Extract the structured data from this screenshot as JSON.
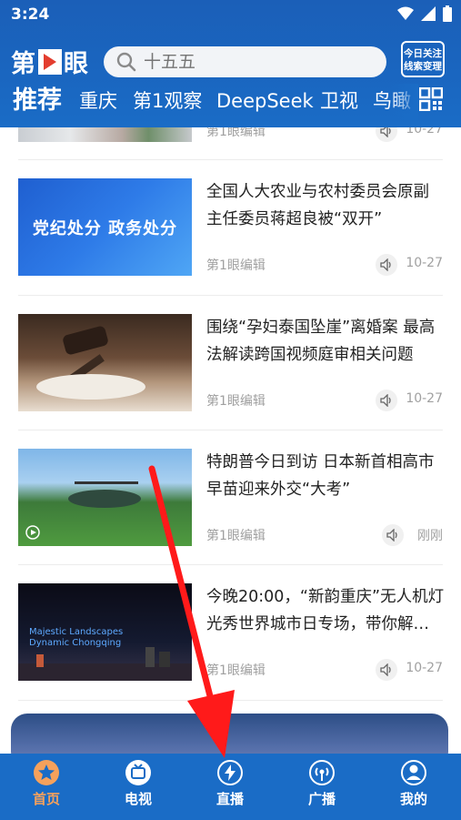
{
  "status": {
    "time": "3:24"
  },
  "header": {
    "logo_text": "第1眼",
    "search_placeholder": "十五五",
    "tips_line1": "今日关注",
    "tips_line2": "线索变理",
    "tabs": [
      "推荐",
      "重庆",
      "第1观察",
      "DeepSeek",
      "卫视",
      "鸟瞰"
    ]
  },
  "news": [
    {
      "title": "",
      "source": "第1眼编辑",
      "date": "10-27"
    },
    {
      "title": "全国人大农业与农村委员会原副主任委员蒋超良被“双开”",
      "source": "第1眼编辑",
      "date": "10-27",
      "thumb_text": "党纪处分  政务处分"
    },
    {
      "title": "围绕“孕妇泰国坠崖”离婚案 最高法解读跨国视频庭审相关问题",
      "source": "第1眼编辑",
      "date": "10-27"
    },
    {
      "title": "特朗普今日到访 日本新首相高市早苗迎来外交“大考”",
      "source": "第1眼编辑",
      "date": "刚刚"
    },
    {
      "title": "今晚20:00，“新韵重庆”无人机灯光秀世界城市日专场，带你解…",
      "source": "第1眼编辑",
      "date": "10-27",
      "thumb_text": "Majestic Landscapes\nDynamic Chongqing"
    }
  ],
  "bottom_nav": [
    {
      "label": "首页",
      "icon": "star-icon"
    },
    {
      "label": "电视",
      "icon": "tv-icon"
    },
    {
      "label": "直播",
      "icon": "lightning-icon"
    },
    {
      "label": "广播",
      "icon": "broadcast-icon"
    },
    {
      "label": "我的",
      "icon": "user-icon"
    }
  ],
  "colors": {
    "brand_blue": "#1a6cc6",
    "active_orange": "#f5a15c",
    "arrow_red": "#ff1a1a"
  }
}
